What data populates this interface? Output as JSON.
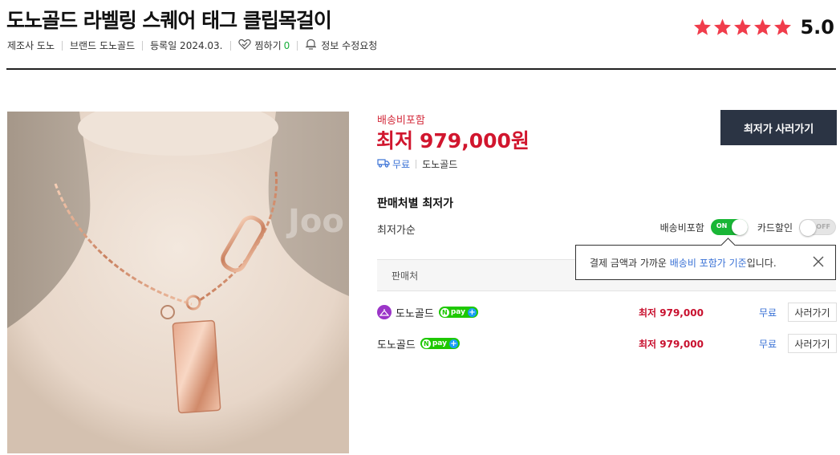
{
  "product": {
    "title": "도노골드 라벨링 스퀘어 태그 클립목걸이",
    "manufacturer": "제조사 도노",
    "brand": "브랜드 도노골드",
    "registered": "등록일 2024.03.",
    "wish_label": "찜하기",
    "wish_count": "0",
    "edit_request": "정보 수정요청"
  },
  "rating": {
    "score": "5.0",
    "stars": 5,
    "star_color": "#f03c4b"
  },
  "image": {
    "watermark": "Joo"
  },
  "pricing": {
    "shipping_included_label": "배송비포함",
    "lowest_label": "최저",
    "lowest_price": "979,000원",
    "delivery_free": "무료",
    "delivery_seller": "도노골드",
    "buy_button": "최저가 사러가기",
    "accent_color": "#d1162e"
  },
  "sellers": {
    "section_title": "판매처별 최저가",
    "sort_label": "최저가순",
    "toggle_shipping_label": "배송비포함",
    "toggle_shipping_state": "ON",
    "toggle_card_label": "카드할인",
    "toggle_card_state": "OFF",
    "tooltip_text_before": "결제 금액과 가까운 ",
    "tooltip_text_highlight": "배송비 포함가 기준",
    "tooltip_text_after": "입니다.",
    "column_seller": "판매처",
    "rows": [
      {
        "seller": "도노골드",
        "has_logo": true,
        "npay": "pay",
        "price": "최저 979,000",
        "shipping": "무료",
        "button": "사러가기"
      },
      {
        "seller": "도노골드",
        "has_logo": false,
        "npay": "pay",
        "price": "최저 979,000",
        "shipping": "무료",
        "button": "사러가기"
      }
    ]
  }
}
